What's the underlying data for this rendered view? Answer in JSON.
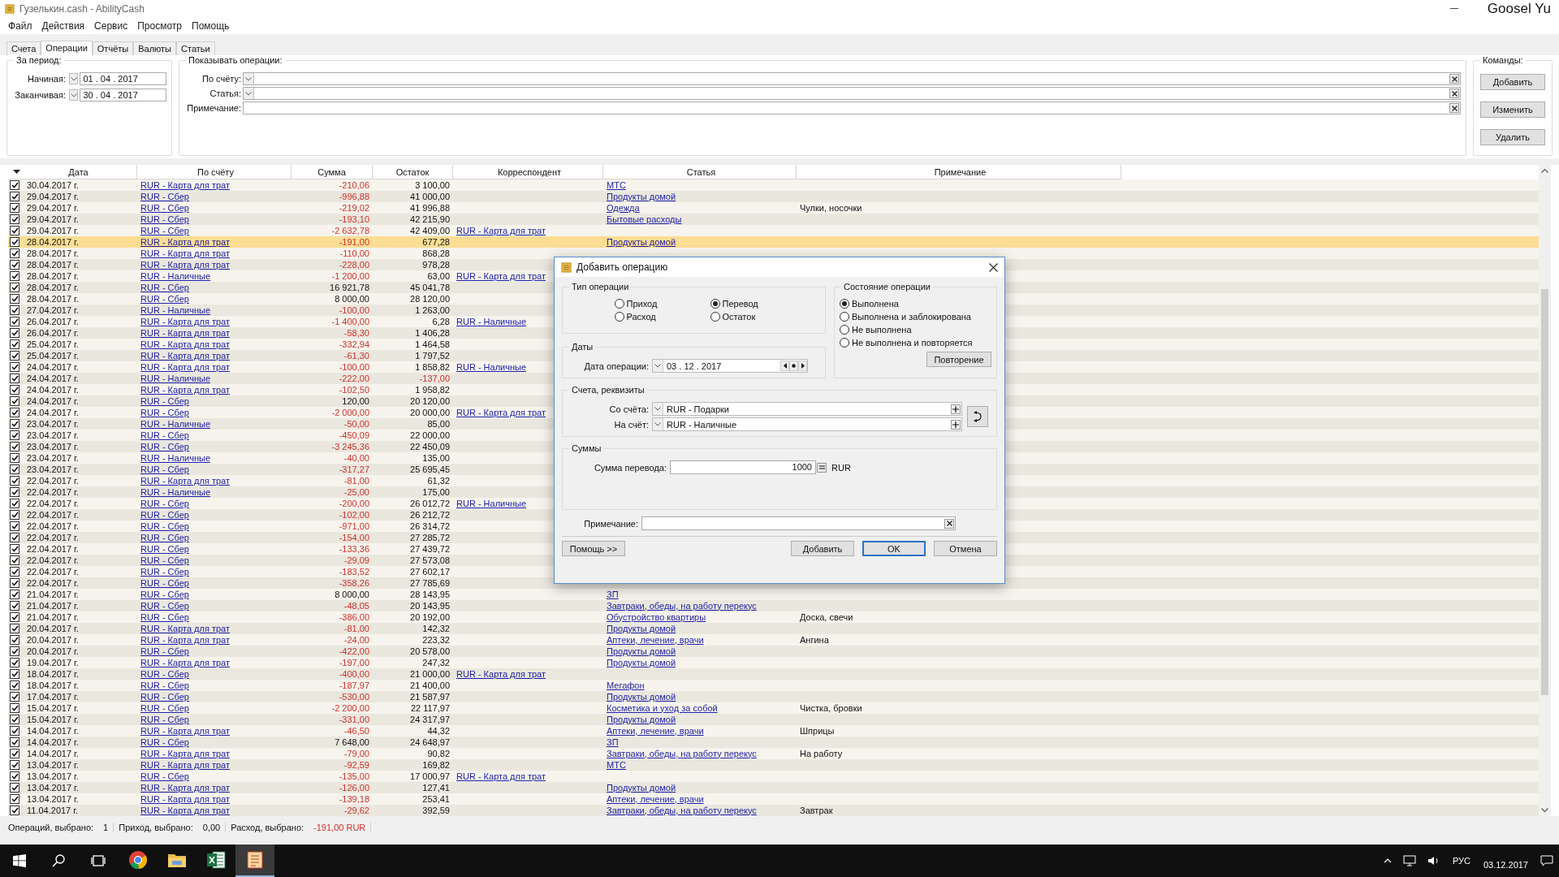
{
  "window": {
    "title": "Гузелькин.cash - AbilityCash",
    "user": "Goosel Yu"
  },
  "menu": [
    "Файл",
    "Действия",
    "Сервис",
    "Просмотр",
    "Помощь"
  ],
  "tabs": [
    {
      "label": "Счета",
      "selected": false
    },
    {
      "label": "Операции",
      "selected": true
    },
    {
      "label": "Отчёты",
      "selected": false
    },
    {
      "label": "Валюты",
      "selected": false
    },
    {
      "label": "Статьи",
      "selected": false
    }
  ],
  "period": {
    "title": "За период:",
    "start": {
      "label": "Начиная:",
      "value": "01 . 04 . 2017"
    },
    "end": {
      "label": "Заканчивая:",
      "value": "30 . 04 . 2017"
    }
  },
  "filter": {
    "title": "Показывать операции:",
    "fields": [
      {
        "label": "По счёту:",
        "kind": "dropdown"
      },
      {
        "label": "Статья:",
        "kind": "dropdown"
      },
      {
        "label": "Примечание:",
        "kind": "text"
      }
    ]
  },
  "commands": {
    "title": "Команды:",
    "buttons": [
      "Добавить",
      "Изменить",
      "Удалить"
    ]
  },
  "table": {
    "columns": [
      "Дата",
      "По счёту",
      "Сумма",
      "Остаток",
      "Корреспондент",
      "Статья",
      "Примечание"
    ],
    "rows": [
      {
        "checked": true,
        "selected": false,
        "date": "30.04.2017 г.",
        "account": "RUR - Карта для трат",
        "sum": "-210,06",
        "sum_negative": true,
        "balance": "3 100,00",
        "balance_negative": false,
        "article": "МТС"
      },
      {
        "checked": true,
        "selected": false,
        "date": "29.04.2017 г.",
        "account": "RUR - Сбер",
        "sum": "-996,88",
        "sum_negative": true,
        "balance": "41 000,00",
        "balance_negative": false,
        "article": "Продукты домой"
      },
      {
        "checked": true,
        "selected": false,
        "date": "29.04.2017 г.",
        "account": "RUR - Сбер",
        "sum": "-219,02",
        "sum_negative": true,
        "balance": "41 996,88",
        "balance_negative": false,
        "article": "Одежда",
        "note": "Чулки, носочки"
      },
      {
        "checked": true,
        "selected": false,
        "date": "29.04.2017 г.",
        "account": "RUR - Сбер",
        "sum": "-193,10",
        "sum_negative": true,
        "balance": "42 215,90",
        "balance_negative": false,
        "article": "Бытовые расходы"
      },
      {
        "checked": true,
        "selected": false,
        "date": "29.04.2017 г.",
        "account": "RUR - Сбер",
        "sum": "-2 632,78",
        "sum_negative": true,
        "balance": "42 409,00",
        "balance_negative": false,
        "correspondent": "RUR - Карта для трат"
      },
      {
        "checked": true,
        "selected": true,
        "date": "28.04.2017 г.",
        "account": "RUR - Карта для трат",
        "sum": "-191,00",
        "sum_negative": true,
        "balance": "677,28",
        "balance_negative": false,
        "article": "Продукты домой"
      },
      {
        "checked": true,
        "selected": false,
        "date": "28.04.2017 г.",
        "account": "RUR - Карта для трат",
        "sum": "-110,00",
        "sum_negative": true,
        "balance": "868,28",
        "balance_negative": false
      },
      {
        "checked": true,
        "selected": false,
        "date": "28.04.2017 г.",
        "account": "RUR - Карта для трат",
        "sum": "-228,00",
        "sum_negative": true,
        "balance": "978,28",
        "balance_negative": false
      },
      {
        "checked": true,
        "selected": false,
        "date": "28.04.2017 г.",
        "account": "RUR - Наличные",
        "sum": "-1 200,00",
        "sum_negative": true,
        "balance": "63,00",
        "balance_negative": false,
        "correspondent": "RUR - Карта для трат"
      },
      {
        "checked": true,
        "selected": false,
        "date": "28.04.2017 г.",
        "account": "RUR - Сбер",
        "sum": "16 921,78",
        "sum_negative": false,
        "balance": "45 041,78",
        "balance_negative": false
      },
      {
        "checked": true,
        "selected": false,
        "date": "28.04.2017 г.",
        "account": "RUR - Сбер",
        "sum": "8 000,00",
        "sum_negative": false,
        "balance": "28 120,00",
        "balance_negative": false
      },
      {
        "checked": true,
        "selected": false,
        "date": "27.04.2017 г.",
        "account": "RUR - Наличные",
        "sum": "-100,00",
        "sum_negative": true,
        "balance": "1 263,00",
        "balance_negative": false
      },
      {
        "checked": true,
        "selected": false,
        "date": "26.04.2017 г.",
        "account": "RUR - Карта для трат",
        "sum": "-1 400,00",
        "sum_negative": true,
        "balance": "6,28",
        "balance_negative": false,
        "correspondent": "RUR - Наличные"
      },
      {
        "checked": true,
        "selected": false,
        "date": "26.04.2017 г.",
        "account": "RUR - Карта для трат",
        "sum": "-58,30",
        "sum_negative": true,
        "balance": "1 406,28",
        "balance_negative": false
      },
      {
        "checked": true,
        "selected": false,
        "date": "25.04.2017 г.",
        "account": "RUR - Карта для трат",
        "sum": "-332,94",
        "sum_negative": true,
        "balance": "1 464,58",
        "balance_negative": false
      },
      {
        "checked": true,
        "selected": false,
        "date": "25.04.2017 г.",
        "account": "RUR - Карта для трат",
        "sum": "-61,30",
        "sum_negative": true,
        "balance": "1 797,52",
        "balance_negative": false
      },
      {
        "checked": true,
        "selected": false,
        "date": "24.04.2017 г.",
        "account": "RUR - Карта для трат",
        "sum": "-100,00",
        "sum_negative": true,
        "balance": "1 858,82",
        "balance_negative": false,
        "correspondent": "RUR - Наличные"
      },
      {
        "checked": true,
        "selected": false,
        "date": "24.04.2017 г.",
        "account": "RUR - Наличные",
        "sum": "-222,00",
        "sum_negative": true,
        "balance": "-137,00",
        "balance_negative": true
      },
      {
        "checked": true,
        "selected": false,
        "date": "24.04.2017 г.",
        "account": "RUR - Карта для трат",
        "sum": "-102,50",
        "sum_negative": true,
        "balance": "1 958,82",
        "balance_negative": false
      },
      {
        "checked": true,
        "selected": false,
        "date": "24.04.2017 г.",
        "account": "RUR - Сбер",
        "sum": "120,00",
        "sum_negative": false,
        "balance": "20 120,00",
        "balance_negative": false
      },
      {
        "checked": true,
        "selected": false,
        "date": "24.04.2017 г.",
        "account": "RUR - Сбер",
        "sum": "-2 000,00",
        "sum_negative": true,
        "balance": "20 000,00",
        "balance_negative": false,
        "correspondent": "RUR - Карта для трат"
      },
      {
        "checked": true,
        "selected": false,
        "date": "23.04.2017 г.",
        "account": "RUR - Наличные",
        "sum": "-50,00",
        "sum_negative": true,
        "balance": "85,00",
        "balance_negative": false
      },
      {
        "checked": true,
        "selected": false,
        "date": "23.04.2017 г.",
        "account": "RUR - Сбер",
        "sum": "-450,09",
        "sum_negative": true,
        "balance": "22 000,00",
        "balance_negative": false
      },
      {
        "checked": true,
        "selected": false,
        "date": "23.04.2017 г.",
        "account": "RUR - Сбер",
        "sum": "-3 245,36",
        "sum_negative": true,
        "balance": "22 450,09",
        "balance_negative": false
      },
      {
        "checked": true,
        "selected": false,
        "date": "23.04.2017 г.",
        "account": "RUR - Наличные",
        "sum": "-40,00",
        "sum_negative": true,
        "balance": "135,00",
        "balance_negative": false
      },
      {
        "checked": true,
        "selected": false,
        "date": "23.04.2017 г.",
        "account": "RUR - Сбер",
        "sum": "-317,27",
        "sum_negative": true,
        "balance": "25 695,45",
        "balance_negative": false
      },
      {
        "checked": true,
        "selected": false,
        "date": "22.04.2017 г.",
        "account": "RUR - Карта для трат",
        "sum": "-81,00",
        "sum_negative": true,
        "balance": "61,32",
        "balance_negative": false
      },
      {
        "checked": true,
        "selected": false,
        "date": "22.04.2017 г.",
        "account": "RUR - Наличные",
        "sum": "-25,00",
        "sum_negative": true,
        "balance": "175,00",
        "balance_negative": false
      },
      {
        "checked": true,
        "selected": false,
        "date": "22.04.2017 г.",
        "account": "RUR - Сбер",
        "sum": "-200,00",
        "sum_negative": true,
        "balance": "26 012,72",
        "balance_negative": false,
        "correspondent": "RUR - Наличные"
      },
      {
        "checked": true,
        "selected": false,
        "date": "22.04.2017 г.",
        "account": "RUR - Сбер",
        "sum": "-102,00",
        "sum_negative": true,
        "balance": "26 212,72",
        "balance_negative": false
      },
      {
        "checked": true,
        "selected": false,
        "date": "22.04.2017 г.",
        "account": "RUR - Сбер",
        "sum": "-971,00",
        "sum_negative": true,
        "balance": "26 314,72",
        "balance_negative": false
      },
      {
        "checked": true,
        "selected": false,
        "date": "22.04.2017 г.",
        "account": "RUR - Сбер",
        "sum": "-154,00",
        "sum_negative": true,
        "balance": "27 285,72",
        "balance_negative": false
      },
      {
        "checked": true,
        "selected": false,
        "date": "22.04.2017 г.",
        "account": "RUR - Сбер",
        "sum": "-133,36",
        "sum_negative": true,
        "balance": "27 439,72",
        "balance_negative": false
      },
      {
        "checked": true,
        "selected": false,
        "date": "22.04.2017 г.",
        "account": "RUR - Сбер",
        "sum": "-29,09",
        "sum_negative": true,
        "balance": "27 573,08",
        "balance_negative": false
      },
      {
        "checked": true,
        "selected": false,
        "date": "22.04.2017 г.",
        "account": "RUR - Сбер",
        "sum": "-183,52",
        "sum_negative": true,
        "balance": "27 602,17",
        "balance_negative": false
      },
      {
        "checked": true,
        "selected": false,
        "date": "22.04.2017 г.",
        "account": "RUR - Сбер",
        "sum": "-358,26",
        "sum_negative": true,
        "balance": "27 785,69",
        "balance_negative": false
      },
      {
        "checked": true,
        "selected": false,
        "date": "21.04.2017 г.",
        "account": "RUR - Сбер",
        "sum": "8 000,00",
        "sum_negative": false,
        "balance": "28 143,95",
        "balance_negative": false,
        "article": "ЗП"
      },
      {
        "checked": true,
        "selected": false,
        "date": "21.04.2017 г.",
        "account": "RUR - Сбер",
        "sum": "-48,05",
        "sum_negative": true,
        "balance": "20 143,95",
        "balance_negative": false,
        "article": "Завтраки, обеды, на работу перекус"
      },
      {
        "checked": true,
        "selected": false,
        "date": "21.04.2017 г.",
        "account": "RUR - Сбер",
        "sum": "-386,00",
        "sum_negative": true,
        "balance": "20 192,00",
        "balance_negative": false,
        "article": "Обустройство квартиры",
        "note": "Доска, свечи"
      },
      {
        "checked": true,
        "selected": false,
        "date": "20.04.2017 г.",
        "account": "RUR - Карта для трат",
        "sum": "-81,00",
        "sum_negative": true,
        "balance": "142,32",
        "balance_negative": false,
        "article": "Продукты домой"
      },
      {
        "checked": true,
        "selected": false,
        "date": "20.04.2017 г.",
        "account": "RUR - Карта для трат",
        "sum": "-24,00",
        "sum_negative": true,
        "balance": "223,32",
        "balance_negative": false,
        "article": "Аптеки, лечение, врачи",
        "note": "Ангина"
      },
      {
        "checked": true,
        "selected": false,
        "date": "20.04.2017 г.",
        "account": "RUR - Сбер",
        "sum": "-422,00",
        "sum_negative": true,
        "balance": "20 578,00",
        "balance_negative": false,
        "article": "Продукты домой"
      },
      {
        "checked": true,
        "selected": false,
        "date": "19.04.2017 г.",
        "account": "RUR - Карта для трат",
        "sum": "-197,00",
        "sum_negative": true,
        "balance": "247,32",
        "balance_negative": false,
        "article": "Продукты домой"
      },
      {
        "checked": true,
        "selected": false,
        "date": "18.04.2017 г.",
        "account": "RUR - Сбер",
        "sum": "-400,00",
        "sum_negative": true,
        "balance": "21 000,00",
        "balance_negative": false,
        "correspondent": "RUR - Карта для трат"
      },
      {
        "checked": true,
        "selected": false,
        "date": "18.04.2017 г.",
        "account": "RUR - Сбер",
        "sum": "-187,97",
        "sum_negative": true,
        "balance": "21 400,00",
        "balance_negative": false,
        "article": "Мегафон"
      },
      {
        "checked": true,
        "selected": false,
        "date": "17.04.2017 г.",
        "account": "RUR - Сбер",
        "sum": "-530,00",
        "sum_negative": true,
        "balance": "21 587,97",
        "balance_negative": false,
        "article": "Продукты домой"
      },
      {
        "checked": true,
        "selected": false,
        "date": "15.04.2017 г.",
        "account": "RUR - Сбер",
        "sum": "-2 200,00",
        "sum_negative": true,
        "balance": "22 117,97",
        "balance_negative": false,
        "article": "Косметика и уход за собой",
        "note": "Чистка, бровки"
      },
      {
        "checked": true,
        "selected": false,
        "date": "15.04.2017 г.",
        "account": "RUR - Сбер",
        "sum": "-331,00",
        "sum_negative": true,
        "balance": "24 317,97",
        "balance_negative": false,
        "article": "Продукты домой"
      },
      {
        "checked": true,
        "selected": false,
        "date": "14.04.2017 г.",
        "account": "RUR - Карта для трат",
        "sum": "-46,50",
        "sum_negative": true,
        "balance": "44,32",
        "balance_negative": false,
        "article": "Аптеки, лечение, врачи",
        "note": "Шприцы"
      },
      {
        "checked": true,
        "selected": false,
        "date": "14.04.2017 г.",
        "account": "RUR - Сбер",
        "sum": "7 648,00",
        "sum_negative": false,
        "balance": "24 648,97",
        "balance_negative": false,
        "article": "ЗП"
      },
      {
        "checked": true,
        "selected": false,
        "date": "14.04.2017 г.",
        "account": "RUR - Карта для трат",
        "sum": "-79,00",
        "sum_negative": true,
        "balance": "90,82",
        "balance_negative": false,
        "article": "Завтраки, обеды, на работу перекус",
        "note": "На работу"
      },
      {
        "checked": true,
        "selected": false,
        "date": "13.04.2017 г.",
        "account": "RUR - Карта для трат",
        "sum": "-92,59",
        "sum_negative": true,
        "balance": "169,82",
        "balance_negative": false,
        "article": "МТС"
      },
      {
        "checked": true,
        "selected": false,
        "date": "13.04.2017 г.",
        "account": "RUR - Сбер",
        "sum": "-135,00",
        "sum_negative": true,
        "balance": "17 000,97",
        "balance_negative": false,
        "correspondent": "RUR - Карта для трат"
      },
      {
        "checked": true,
        "selected": false,
        "date": "13.04.2017 г.",
        "account": "RUR - Карта для трат",
        "sum": "-126,00",
        "sum_negative": true,
        "balance": "127,41",
        "balance_negative": false,
        "article": "Продукты домой"
      },
      {
        "checked": true,
        "selected": false,
        "date": "13.04.2017 г.",
        "account": "RUR - Карта для трат",
        "sum": "-139,18",
        "sum_negative": true,
        "balance": "253,41",
        "balance_negative": false,
        "article": "Аптеки, лечение, врачи"
      },
      {
        "checked": true,
        "selected": false,
        "date": "11.04.2017 г.",
        "account": "RUR - Карта для трат",
        "sum": "-29,62",
        "sum_negative": true,
        "balance": "392,59",
        "balance_negative": false,
        "article": "Завтраки, обеды, на работу перекус",
        "note": "Завтрак"
      }
    ]
  },
  "status_bar": [
    {
      "label": "Операций, выбрано:",
      "value": "1",
      "negative": false
    },
    {
      "label": "Приход, выбрано:",
      "value": "0,00",
      "negative": false
    },
    {
      "label": "Расход, выбрано:",
      "value": "-191,00 RUR",
      "negative": true
    }
  ],
  "dialog": {
    "title": "Добавить операцию",
    "type_group": {
      "title": "Тип операции",
      "options": [
        {
          "label": "Приход",
          "selected": false
        },
        {
          "label": "Перевод",
          "selected": true
        },
        {
          "label": "Расход",
          "selected": false
        },
        {
          "label": "Остаток",
          "selected": false
        }
      ]
    },
    "state_group": {
      "title": "Состояние операции",
      "options": [
        {
          "label": "Выполнена",
          "selected": true
        },
        {
          "label": "Выполнена и заблокирована",
          "selected": false
        },
        {
          "label": "Не выполнена",
          "selected": false
        },
        {
          "label": "Не выполнена и повторяется",
          "selected": false
        }
      ],
      "button": "Повторение"
    },
    "dates_group": {
      "title": "Даты",
      "label": "Дата операции:",
      "value": "03 . 12 . 2017"
    },
    "accounts_group": {
      "title": "Счета, реквизиты",
      "from": {
        "label": "Со счёта:",
        "value": "RUR - Подарки"
      },
      "to": {
        "label": "На счёт:",
        "value": "RUR - Наличные"
      }
    },
    "sums_group": {
      "title": "Суммы",
      "label": "Сумма перевода:",
      "value": "1000",
      "currency": "RUR"
    },
    "note": {
      "label": "Примечание:"
    },
    "buttons": [
      {
        "label": "Помощь >>",
        "default": false
      },
      {
        "label": "Добавить",
        "default": false
      },
      {
        "label": "OK",
        "default": true
      },
      {
        "label": "Отмена",
        "default": false
      }
    ]
  },
  "taskbar": {
    "apps": [
      {
        "kind": "browser",
        "selected": false
      },
      {
        "kind": "folder",
        "selected": false
      },
      {
        "kind": "spreadsheet",
        "selected": false
      },
      {
        "kind": "cash",
        "selected": true
      }
    ],
    "language": "РУС",
    "date": "03.12.2017"
  }
}
